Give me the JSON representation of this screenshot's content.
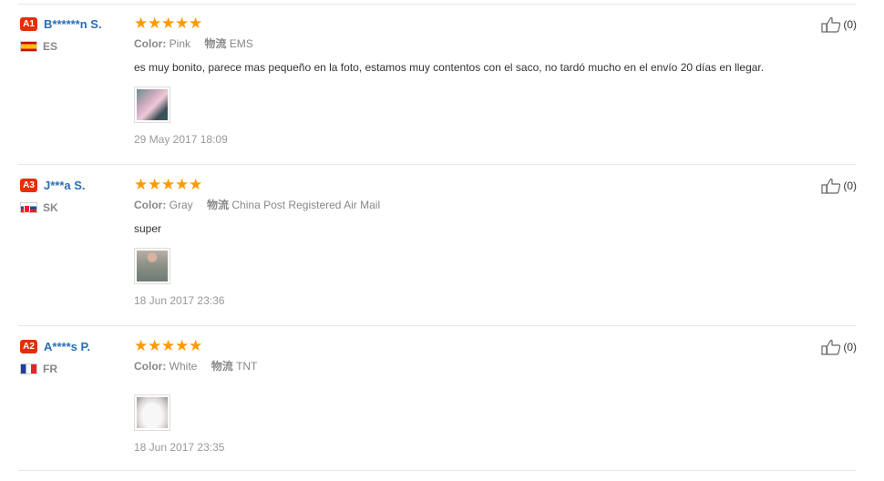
{
  "reviews": [
    {
      "level": "A1",
      "buyer_name": "B******n S.",
      "country_code": "ES",
      "flag_icon": "spain-flag-icon",
      "stars": 5,
      "color_label": "Color:",
      "color_value": "Pink",
      "shipping_label": "物流",
      "shipping_value": "EMS",
      "text": "es muy bonito, parece mas pequeño en la foto, estamos muy contentos con el saco, no tardó mucho en el envío 20 días en llegar.",
      "date": "29 May 2017 18:09",
      "helpful_count": "(0)"
    },
    {
      "level": "A3",
      "buyer_name": "J***a S.",
      "country_code": "SK",
      "flag_icon": "slovakia-flag-icon",
      "stars": 5,
      "color_label": "Color:",
      "color_value": "Gray",
      "shipping_label": "物流",
      "shipping_value": "China Post Registered Air Mail",
      "text": "super",
      "date": "18 Jun 2017 23:36",
      "helpful_count": "(0)"
    },
    {
      "level": "A2",
      "buyer_name": "A****s P.",
      "country_code": "FR",
      "flag_icon": "france-flag-icon",
      "stars": 5,
      "color_label": "Color:",
      "color_value": "White",
      "shipping_label": "物流",
      "shipping_value": "TNT",
      "text": "",
      "date": "18 Jun 2017 23:35",
      "helpful_count": "(0)"
    }
  ],
  "colors": {
    "badge": "#e62e04",
    "buyer_name": "#2a6fb6",
    "star": "#ff9a00",
    "meta_text": "#888888",
    "divider": "#e8e8e8"
  },
  "icons": {
    "star": "star-icon",
    "helpful": "thumbs-up-icon"
  }
}
